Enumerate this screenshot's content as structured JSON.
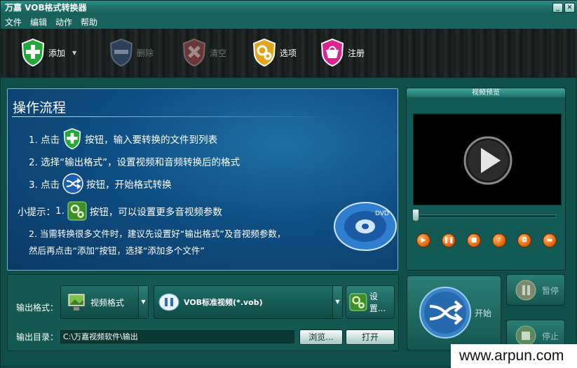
{
  "window": {
    "title": "万嘉 VOB格式转换器"
  },
  "window_buttons": {
    "minimize": "_",
    "close": "×"
  },
  "menu": [
    "文件",
    "编辑",
    "动作",
    "帮助"
  ],
  "toolbar": {
    "add": "添加",
    "delete": "删除",
    "clear": "清空",
    "options": "选项",
    "register": "注册"
  },
  "guide": {
    "title": "操作流程",
    "step1_pre": "1. 点击",
    "step1_post": "按钮，输入要转换的文件到列表",
    "step2": "2. 选择“输出格式”，设置视频和音频转换后的格式",
    "step3_pre": "3. 点击",
    "step3_post": "按钮，开始格式转换",
    "tip_label": "小提示：",
    "tip1_pre": "1.",
    "tip1_post": "按钮，可以设置更多音视频参数",
    "tip2_line1": "2. 当需转换很多文件时，建议先设置好“输出格式”及音视频参数，",
    "tip2_line2": "然后再点击“添加”按钮，选择“添加多个文件”",
    "dvd_label": "DVD"
  },
  "preview": {
    "title": "视频预览"
  },
  "output": {
    "format_label": "输出格式：",
    "dir_label": "输出目录：",
    "format_category": "视频格式",
    "format_value": "VOB标准视频(*.vob)",
    "settings": "设置...",
    "dir_value": "C:\\万嘉视频软件\\输出",
    "browse": "浏览...",
    "open": "打开"
  },
  "actions": {
    "start": "开始",
    "pause": "暂停",
    "stop": "停止"
  },
  "watermark": "www.arpun.com"
}
